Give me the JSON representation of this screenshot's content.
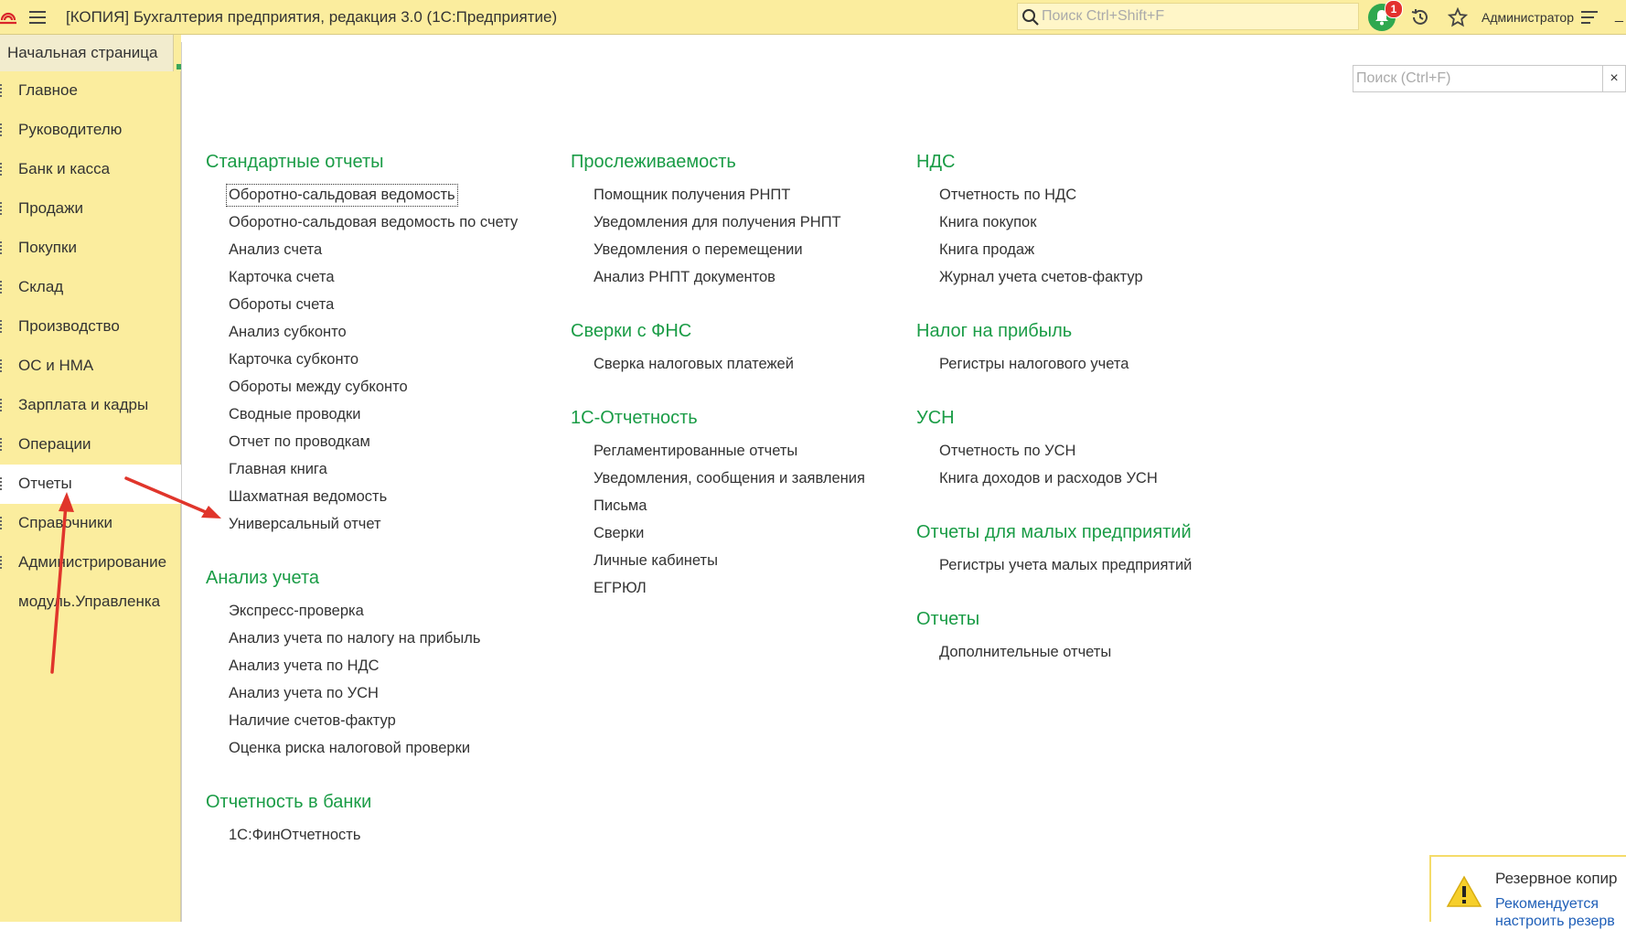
{
  "window": {
    "title": "[КОПИЯ] Бухгалтерия предприятия, редакция 3.0  (1С:Предприятие)",
    "search_placeholder": "Поиск Ctrl+Shift+F",
    "notifications_count": "1",
    "user": "Администратор"
  },
  "tabs": {
    "home": "Начальная страница"
  },
  "sidebar": {
    "items": [
      {
        "label": "Главное"
      },
      {
        "label": "Руководителю"
      },
      {
        "label": "Банк и касса"
      },
      {
        "label": "Продажи"
      },
      {
        "label": "Покупки"
      },
      {
        "label": "Склад"
      },
      {
        "label": "Производство"
      },
      {
        "label": "ОС и НМА"
      },
      {
        "label": "Зарплата и кадры"
      },
      {
        "label": "Операции"
      },
      {
        "label": "Отчеты"
      },
      {
        "label": "Справочники"
      },
      {
        "label": "Администрирование"
      },
      {
        "label": "модуль.Управленка"
      }
    ],
    "active": "Отчеты"
  },
  "main": {
    "search_placeholder": "Поиск (Ctrl+F)",
    "clear_glyph": "×",
    "columns": [
      [
        {
          "title": "Стандартные отчеты",
          "items": [
            "Оборотно-сальдовая ведомость",
            "Оборотно-сальдовая ведомость по счету",
            "Анализ счета",
            "Карточка счета",
            "Обороты счета",
            "Анализ субконто",
            "Карточка субконто",
            "Обороты между субконто",
            "Сводные проводки",
            "Отчет по проводкам",
            "Главная книга",
            "Шахматная ведомость",
            "Универсальный отчет"
          ]
        },
        {
          "title": "Анализ учета",
          "items": [
            "Экспресс-проверка",
            "Анализ учета по налогу на прибыль",
            "Анализ учета по НДС",
            "Анализ учета по УСН",
            "Наличие счетов-фактур",
            "Оценка риска налоговой проверки"
          ]
        },
        {
          "title": "Отчетность в банки",
          "items": [
            "1С:ФинОтчетность"
          ]
        }
      ],
      [
        {
          "title": "Прослеживаемость",
          "items": [
            "Помощник получения РНПТ",
            "Уведомления для получения РНПТ",
            "Уведомления о перемещении",
            "Анализ РНПТ документов"
          ]
        },
        {
          "title": "Сверки с ФНС",
          "items": [
            "Сверка налоговых платежей"
          ]
        },
        {
          "title": "1С-Отчетность",
          "items": [
            "Регламентированные отчеты",
            "Уведомления, сообщения и заявления",
            "Письма",
            "Сверки",
            "Личные кабинеты",
            "ЕГРЮЛ"
          ]
        }
      ],
      [
        {
          "title": "НДС",
          "items": [
            "Отчетность по НДС",
            "Книга покупок",
            "Книга продаж",
            "Журнал учета счетов-фактур"
          ]
        },
        {
          "title": "Налог на прибыль",
          "items": [
            "Регистры налогового учета"
          ]
        },
        {
          "title": "УСН",
          "items": [
            "Отчетность по УСН",
            "Книга доходов и расходов УСН"
          ]
        },
        {
          "title": "Отчеты для малых предприятий",
          "items": [
            "Регистры учета малых предприятий"
          ]
        },
        {
          "title": "Отчеты",
          "items": [
            "Дополнительные отчеты"
          ]
        }
      ]
    ]
  },
  "notice": {
    "title": "Резервное копир",
    "link": "Рекомендуется",
    "link2": "настроить резерв"
  },
  "colors": {
    "sidebar_bg": "#fbed9e",
    "group_title": "#1a9c46",
    "annotation_arrow": "#e0352b"
  }
}
